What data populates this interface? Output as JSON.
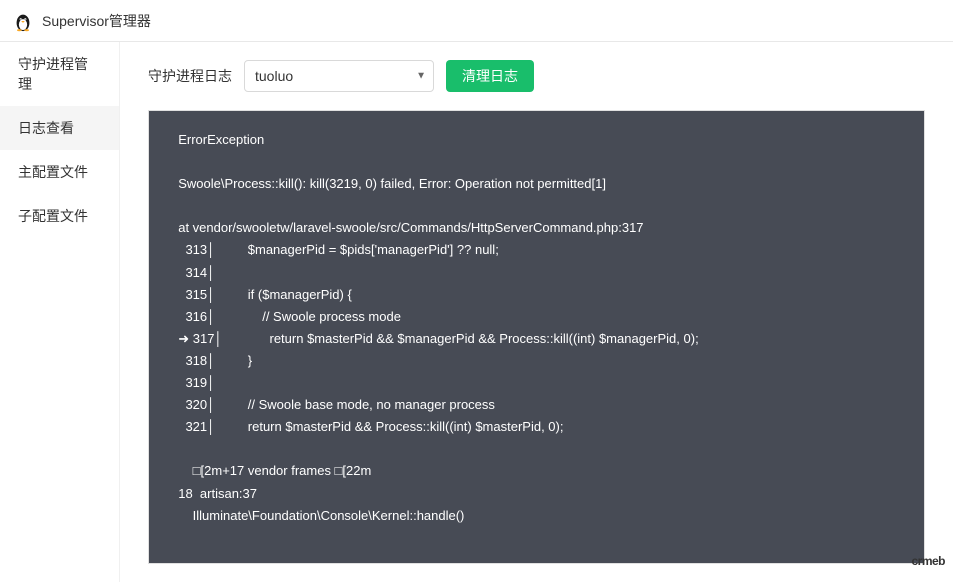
{
  "header": {
    "title": "Supervisor管理器"
  },
  "sidebar": {
    "items": [
      {
        "label": "守护进程管理"
      },
      {
        "label": "日志查看"
      },
      {
        "label": "主配置文件"
      },
      {
        "label": "子配置文件"
      }
    ]
  },
  "toolbar": {
    "label": "守护进程日志",
    "select_value": "tuoluo",
    "clear_label": "清理日志"
  },
  "log_content": "  ErrorException\n\n  Swoole\\Process::kill(): kill(3219, 0) failed, Error: Operation not permitted[1]\n\n  at vendor/swooletw/laravel-swoole/src/Commands/HttpServerCommand.php:317\n    313│         $managerPid = $pids['managerPid'] ?? null;\n    314│ \n    315│         if ($managerPid) {\n    316│             // Swoole process mode\n  ➜ 317│             return $masterPid && $managerPid && Process::kill((int) $managerPid, 0);\n    318│         }\n    319│ \n    320│         // Swoole base mode, no manager process\n    321│         return $masterPid && Process::kill((int) $masterPid, 0);\n\n      □[2m+17 vendor frames □[22m\n  18  artisan:37\n      Illuminate\\Foundation\\Console\\Kernel::handle()\n",
  "brand": "crmeb"
}
